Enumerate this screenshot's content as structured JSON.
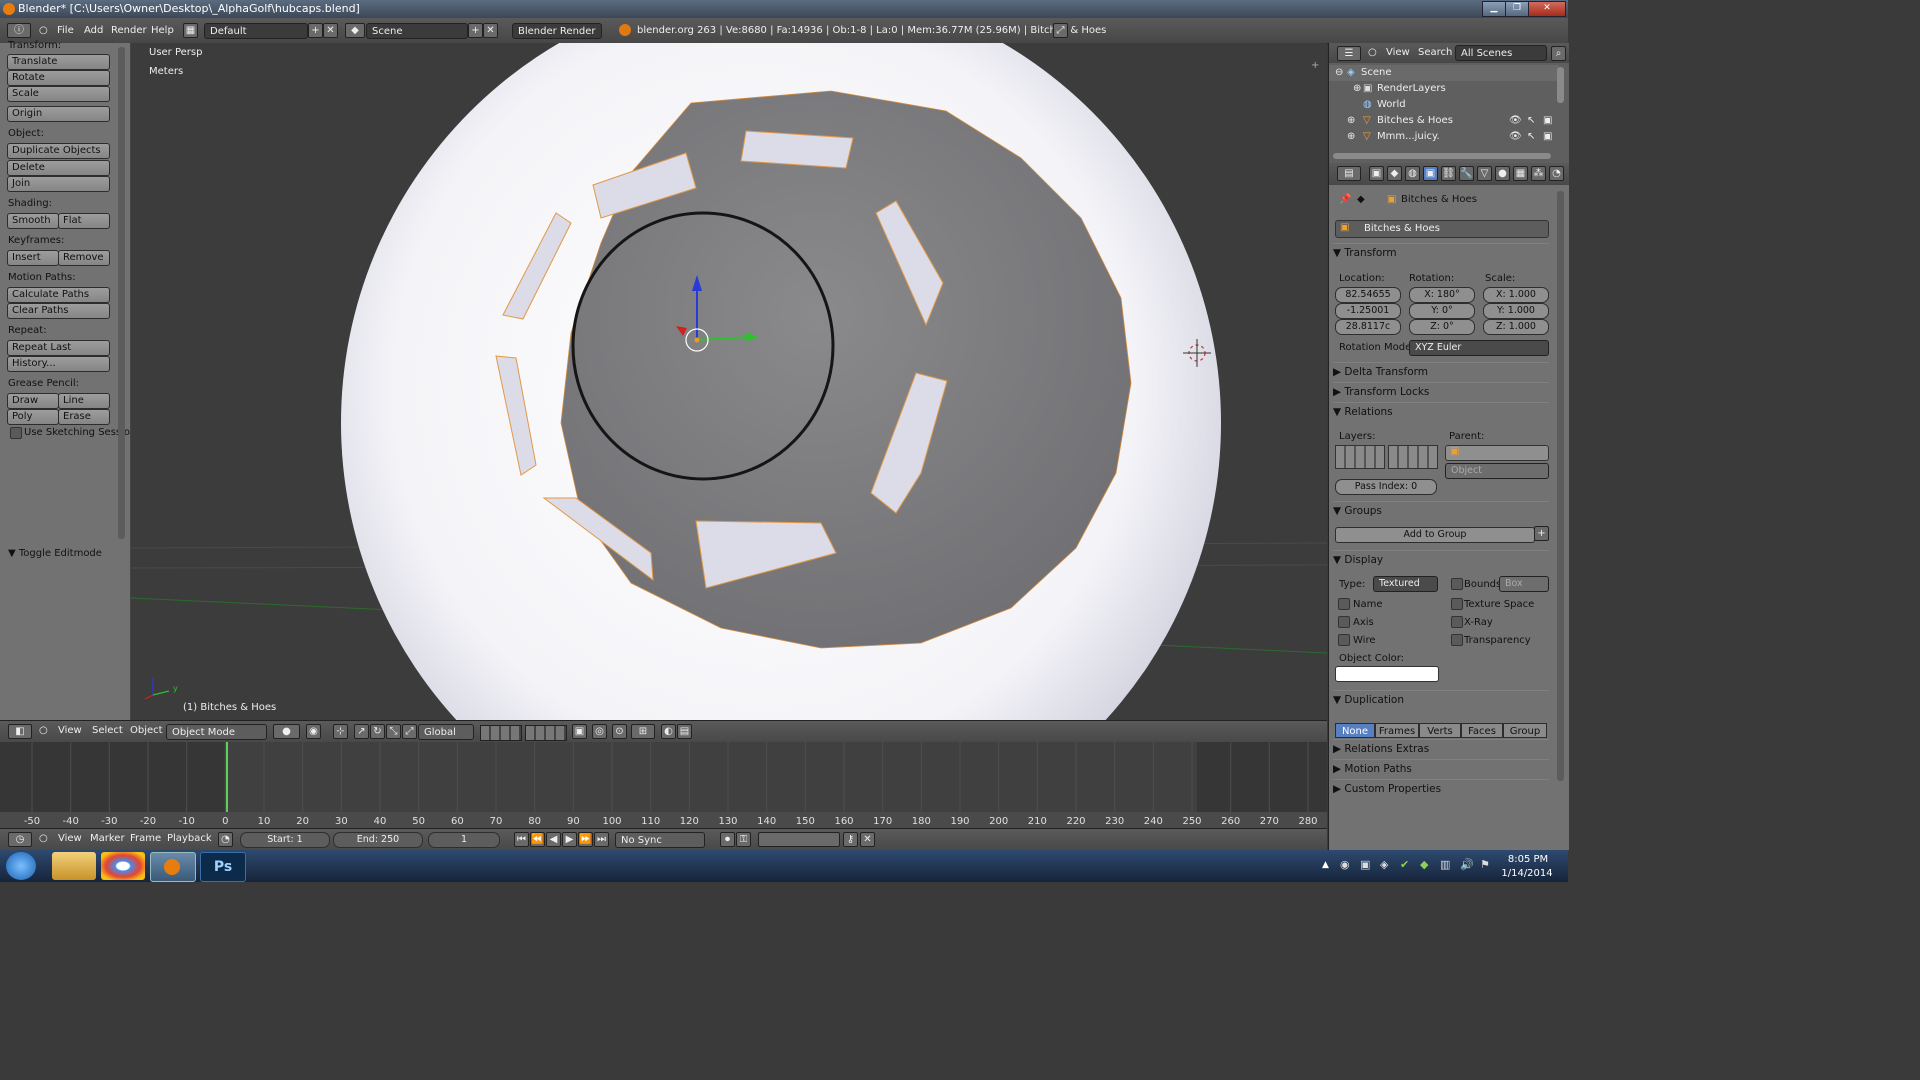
{
  "titlebar": {
    "title": "Blender* [C:\\Users\\Owner\\Desktop\\_AlphaGolf\\hubcaps.blend]"
  },
  "infobar": {
    "menus": [
      "File",
      "Add",
      "Render",
      "Help"
    ],
    "layout": "Default",
    "scene": "Scene",
    "engine": "Blender Render",
    "stats": "blender.org 263 | Ve:8680 | Fa:14936 | Ob:1-8 | La:0 | Mem:36.77M (25.96M) | Bitches & Hoes"
  },
  "toolshelf": {
    "transform_header": "Transform:",
    "translate": "Translate",
    "rotate": "Rotate",
    "scale": "Scale",
    "origin": "Origin",
    "object_header": "Object:",
    "duplicate": "Duplicate Objects",
    "delete": "Delete",
    "join": "Join",
    "shading_header": "Shading:",
    "smooth": "Smooth",
    "flat": "Flat",
    "keyframes_header": "Keyframes:",
    "insert": "Insert",
    "remove": "Remove",
    "motion_header": "Motion Paths:",
    "calculate": "Calculate Paths",
    "clear_paths": "Clear Paths",
    "repeat_header": "Repeat:",
    "repeat_last": "Repeat Last",
    "history": "History...",
    "grease_header": "Grease Pencil:",
    "draw": "Draw",
    "line": "Line",
    "poly": "Poly",
    "erase": "Erase",
    "sketching": "Use Sketching Sessio",
    "toggle_editmode": "Toggle Editmode"
  },
  "viewport": {
    "view_name": "User Persp",
    "units": "Meters",
    "object_label": "(1) Bitches & Hoes",
    "axis_y": "y"
  },
  "vphead": {
    "menus": [
      "View",
      "Select",
      "Object"
    ],
    "mode": "Object Mode",
    "orientation": "Global"
  },
  "timeline": {
    "ticks": [
      -50,
      -40,
      -30,
      -20,
      -10,
      0,
      10,
      20,
      30,
      40,
      50,
      60,
      70,
      80,
      90,
      100,
      110,
      120,
      130,
      140,
      150,
      160,
      170,
      180,
      190,
      200,
      210,
      220,
      230,
      240,
      250,
      260,
      270,
      280
    ],
    "menus": [
      "View",
      "Marker",
      "Frame",
      "Playback"
    ],
    "start": "Start: 1",
    "end": "End: 250",
    "current": "1",
    "sync": "No Sync"
  },
  "outliner": {
    "menus": [
      "View",
      "Search"
    ],
    "filter": "All Scenes",
    "rows": [
      "Scene",
      "RenderLayers",
      "World",
      "Bitches & Hoes",
      "Mmm...juicy."
    ]
  },
  "properties": {
    "breadcrumb": "Bitches & Hoes",
    "object_name": "Bitches & Hoes",
    "transform": "Transform",
    "location_label": "Location:",
    "rotation_label": "Rotation:",
    "scale_label": "Scale:",
    "loc_x": "82.54655",
    "loc_y": "-1.25001",
    "loc_z": "28.8117c",
    "rot_x": "X: 180°",
    "rot_y": "Y: 0°",
    "rot_z": "Z: 0°",
    "scale_x": "X: 1.000",
    "scale_y": "Y: 1.000",
    "scale_z": "Z: 1.000",
    "rotation_mode_label": "Rotation Mode:",
    "rotation_mode": "XYZ Euler",
    "delta": "Delta Transform",
    "locks": "Transform Locks",
    "relations": "Relations",
    "layers_label": "Layers:",
    "parent_label": "Parent:",
    "parent_type": "Object",
    "pass_index": "Pass Index: 0",
    "groups": "Groups",
    "add_to_group": "Add to Group",
    "display": "Display",
    "type_label": "Type:",
    "type_value": "Textured",
    "bounds": "Bounds",
    "bounds_type": "Box",
    "name": "Name",
    "texture_space": "Texture Space",
    "axis": "Axis",
    "xray": "X-Ray",
    "wire": "Wire",
    "transparency": "Transparency",
    "object_color": "Object Color:",
    "duplication": "Duplication",
    "dup_tabs": [
      "None",
      "Frames",
      "Verts",
      "Faces",
      "Group"
    ],
    "relations_extras": "Relations Extras",
    "motion_paths": "Motion Paths",
    "custom_props": "Custom Properties"
  },
  "taskbar": {
    "time": "8:05 PM",
    "date": "1/14/2014"
  }
}
